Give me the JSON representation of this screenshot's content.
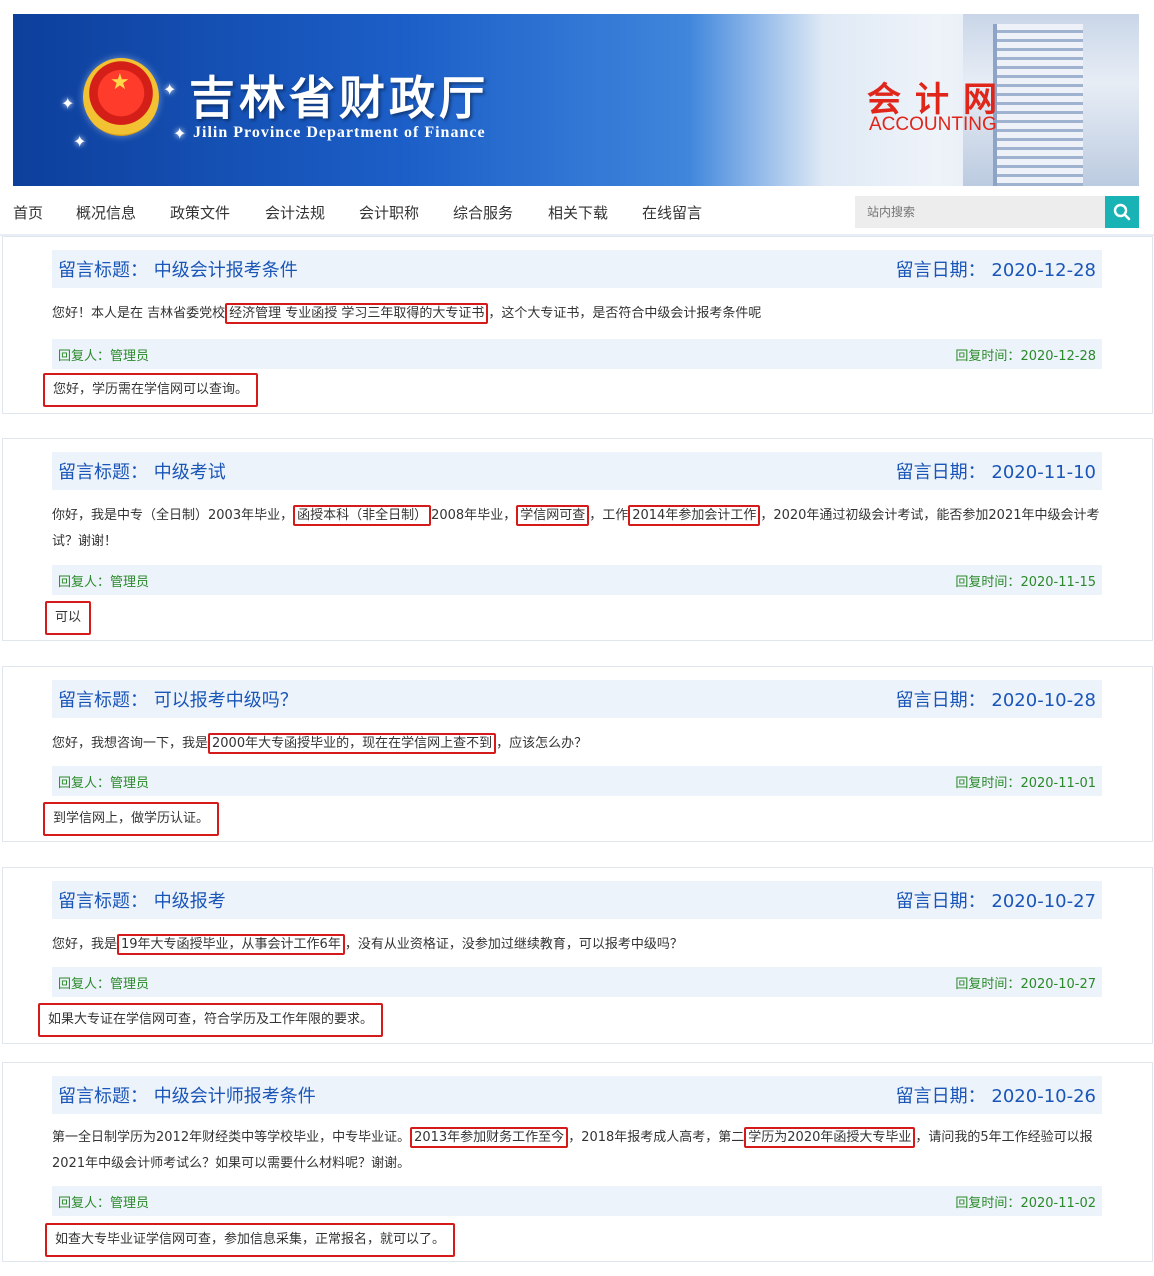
{
  "header": {
    "title_cn": "吉林省财政厅",
    "title_en": "Jilin Province Department of Finance",
    "accounting_cn": "会计网",
    "accounting_en": "ACCOUNTING"
  },
  "nav": {
    "items": [
      "首页",
      "概况信息",
      "政策文件",
      "会计法规",
      "会计职称",
      "综合服务",
      "相关下载",
      "在线留言"
    ]
  },
  "search": {
    "placeholder": "站内搜索"
  },
  "labels": {
    "title_prefix": "留言标题：",
    "date_prefix": "留言日期：",
    "replier": "回复人：管理员",
    "reply_time_prefix": "回复时间："
  },
  "messages": [
    {
      "title": "中级会计报考条件",
      "date": "2020-12-28",
      "body_parts": [
        "您好！本人是在 吉林省委党校",
        "经济管理 专业函授 学习三年取得的大专证书",
        "，这个大专证书，是否符合中级会计报考条件呢"
      ],
      "reply_time": "2020-12-28",
      "answer": "您好，学历需在学信网可以查询。"
    },
    {
      "title": "中级考试",
      "date": "2020-11-10",
      "body_parts": [
        "你好，我是中专（全日制）2003年毕业，",
        "函授本科（非全日制）",
        "2008年毕业，",
        "学信网可查",
        "，工作",
        "2014年参加会计工作",
        "，2020年通过初级会计考试，能否参加2021年中级会计考试？谢谢！"
      ],
      "reply_time": "2020-11-15",
      "answer": "可以"
    },
    {
      "title": "可以报考中级吗？",
      "date": "2020-10-28",
      "body_parts": [
        "您好，我想咨询一下，我是",
        "2000年大专函授毕业的，现在在学信网上查不到",
        "，应该怎么办？"
      ],
      "reply_time": "2020-11-01",
      "answer": "到学信网上，做学历认证。"
    },
    {
      "title": "中级报考",
      "date": "2020-10-27",
      "body_parts": [
        "您好，我是",
        "19年大专函授毕业，从事会计工作6年",
        "，没有从业资格证，没参加过继续教育，可以报考中级吗？"
      ],
      "reply_time": "2020-10-27",
      "answer": "如果大专证在学信网可查，符合学历及工作年限的要求。"
    },
    {
      "title": "中级会计师报考条件",
      "date": "2020-10-26",
      "body_parts": [
        "第一全日制学历为2012年财经类中等学校毕业，中专毕业证。",
        "2013年参加财务工作至今",
        "，2018年报考成人高考，第二",
        "学历为2020年函授大专毕业",
        "，请问我的5年工作经验可以报2021年中级会计师考试么？如果可以需要什么材料呢？谢谢。"
      ],
      "reply_time": "2020-11-02",
      "answer": "如查大专毕业证学信网可查，参加信息采集，正常报名，就可以了。"
    }
  ]
}
